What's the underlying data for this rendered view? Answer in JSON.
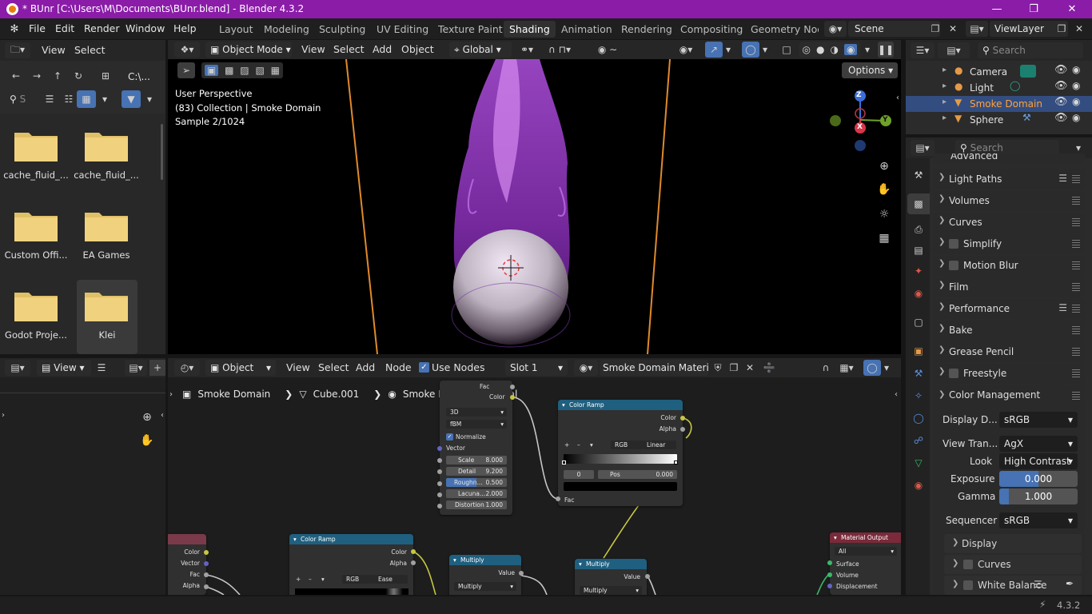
{
  "window": {
    "title": "* BUnr [C:\\Users\\M\\Documents\\BUnr.blend] - Blender 4.3.2"
  },
  "menu": {
    "file": "File",
    "edit": "Edit",
    "render": "Render",
    "window": "Window",
    "help": "Help"
  },
  "workspaces": [
    "Layout",
    "Modeling",
    "Sculpting",
    "UV Editing",
    "Texture Paint",
    "Shading",
    "Animation",
    "Rendering",
    "Compositing",
    "Geometry Node"
  ],
  "scene": {
    "name": "Scene",
    "view_layer": "ViewLayer"
  },
  "filebrowser": {
    "view": "View",
    "select": "Select",
    "path": "C:\\...",
    "search_placeholder": "S",
    "folders": [
      "cache_fluid_...",
      "cache_fluid_...",
      "Custom Offi...",
      "EA Games",
      "Godot Proje...",
      "Klei"
    ]
  },
  "viewport": {
    "mode": "Object Mode",
    "view": "View",
    "select": "Select",
    "add": "Add",
    "object": "Object",
    "transform": "Global",
    "options": "Options",
    "overlay_line1": "User Perspective",
    "overlay_line2": "(83) Collection | Smoke Domain",
    "overlay_line3": "Sample 2/1024",
    "gizmo": {
      "z": "Z",
      "y": "Y",
      "x": "X"
    }
  },
  "outliner": {
    "search_placeholder": "Search",
    "items": [
      "Camera",
      "Light",
      "Smoke Domain",
      "Sphere"
    ]
  },
  "properties": {
    "search_placeholder": "Search",
    "clipped_top": "Advanced",
    "sections": [
      "Light Paths",
      "Volumes",
      "Curves",
      "Simplify",
      "Motion Blur",
      "Film",
      "Performance",
      "Bake",
      "Grease Pencil",
      "Freestyle"
    ],
    "color_management": {
      "title": "Color Management",
      "display_label": "Display D...",
      "display_value": "sRGB",
      "view_label": "View Tran...",
      "view_value": "AgX",
      "look_label": "Look",
      "look_value": "High Contrast",
      "exposure_label": "Exposure",
      "exposure_value": "0.000",
      "exposure_fill": 0.5,
      "gamma_label": "Gamma",
      "gamma_value": "1.000",
      "gamma_fill": 0.12,
      "sequencer_label": "Sequencer",
      "sequencer_value": "sRGB",
      "sub_display": "Display",
      "sub_curves": "Curves",
      "sub_white": "White Balance"
    }
  },
  "image_editor": {
    "view": "View"
  },
  "node_editor": {
    "object": "Object",
    "view": "View",
    "select": "Select",
    "add": "Add",
    "node": "Node",
    "use_nodes": "Use Nodes",
    "slot": "Slot 1",
    "material": "Smoke Domain Material",
    "breadcrumb": [
      "Smoke Domain",
      "Cube.001",
      "Smoke Domain Material"
    ],
    "noise": {
      "out_fac": "Fac",
      "out_color": "Color",
      "dim": "3D",
      "type": "fBM",
      "normalize": "Normalize",
      "vector": "Vector",
      "fields": [
        [
          "Scale",
          "8.000"
        ],
        [
          "Detail",
          "9.200"
        ],
        [
          "Roughn...",
          "0.500"
        ],
        [
          "Lacuna...",
          "2.000"
        ],
        [
          "Distortion",
          "1.000"
        ]
      ],
      "roughness_fill": 0.5
    },
    "ramp1": {
      "title": "Color Ramp",
      "color": "Color",
      "alpha": "Alpha",
      "mode": "RGB",
      "interp": "Linear",
      "index": "0",
      "pos_label": "Pos",
      "pos": "0.000",
      "fac": "Fac"
    },
    "ramp2": {
      "title": "Color Ramp",
      "color": "Color",
      "alpha": "Alpha",
      "mode": "RGB",
      "interp": "Ease"
    },
    "left_node": {
      "color": "Color",
      "vector": "Vector",
      "fac": "Fac",
      "alpha": "Alpha"
    },
    "mult1": {
      "title": "Multiply",
      "value": "Value",
      "op": "Multiply"
    },
    "mult2": {
      "title": "Multiply",
      "value": "Value",
      "op": "Multiply"
    },
    "output": {
      "title": "Material Output",
      "target": "All",
      "surface": "Surface",
      "volume": "Volume",
      "displacement": "Displacement"
    }
  },
  "status": {
    "version": "4.3.2"
  }
}
